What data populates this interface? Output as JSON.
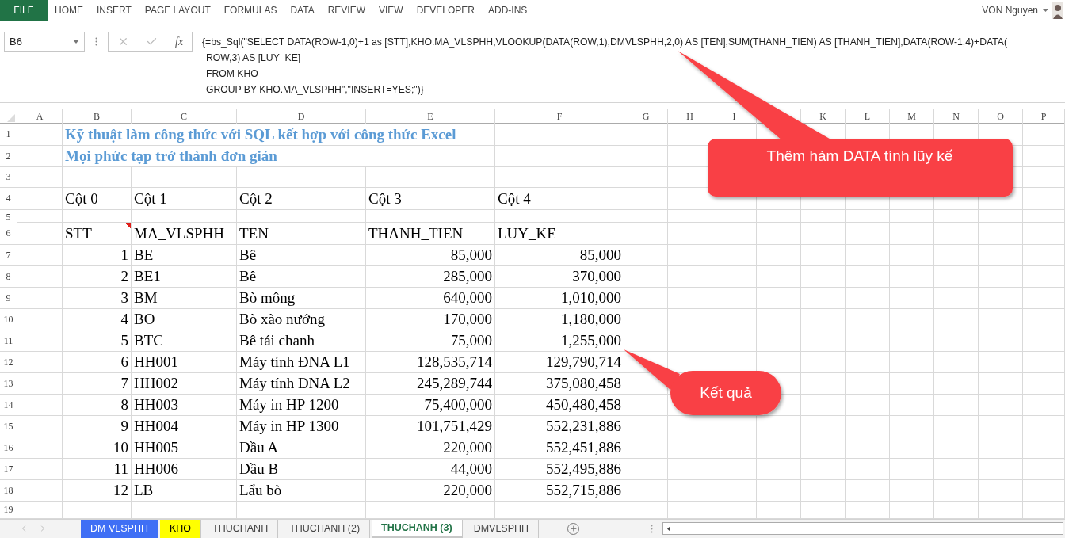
{
  "ribbon_tabs": [
    {
      "label": "FILE",
      "kind": "file"
    },
    {
      "label": "HOME",
      "kind": "tab"
    },
    {
      "label": "INSERT",
      "kind": "tab"
    },
    {
      "label": "PAGE LAYOUT",
      "kind": "tab"
    },
    {
      "label": "FORMULAS",
      "kind": "tab"
    },
    {
      "label": "DATA",
      "kind": "tab"
    },
    {
      "label": "REVIEW",
      "kind": "tab"
    },
    {
      "label": "VIEW",
      "kind": "tab"
    },
    {
      "label": "DEVELOPER",
      "kind": "tab"
    },
    {
      "label": "ADD-INS",
      "kind": "tab"
    }
  ],
  "user": {
    "name": "VON Nguyen"
  },
  "formula_bar": {
    "name_box": "B6",
    "function_label": "fx",
    "lines": [
      "{=bs_Sql(\"SELECT DATA(ROW-1,0)+1 as [STT],KHO.MA_VLSPHH,VLOOKUP(DATA(ROW,1),DMVLSPHH,2,0) AS [TEN],SUM(THANH_TIEN) AS [THANH_TIEN],DATA(ROW-1,4)+DATA(",
      "ROW,3) AS [LUY_KE]",
      "FROM KHO",
      "GROUP BY KHO.MA_VLSPHH\",\"INSERT=YES;\")}"
    ]
  },
  "columns": [
    "A",
    "B",
    "C",
    "D",
    "E",
    "F",
    "G",
    "H",
    "I",
    null,
    "K",
    "L",
    "M",
    "N",
    "O",
    "P"
  ],
  "rows": [
    {
      "number": "1",
      "kind": "title",
      "cells": {
        "B": "Kỹ thuật làm công thức với SQL kết hợp với công thức Excel"
      }
    },
    {
      "number": "2",
      "kind": "title",
      "cells": {
        "B": "Mọi phức tạp trở thành đơn giản"
      }
    },
    {
      "number": "3",
      "kind": "blank",
      "cells": {}
    },
    {
      "number": "4",
      "kind": "header",
      "cells": {
        "B": "Cột 0",
        "C": "Cột 1",
        "D": "Cột 2",
        "E": "Cột 3",
        "F": "Cột 4"
      }
    },
    {
      "number": "5",
      "kind": "spacer",
      "cells": {}
    },
    {
      "number": "6",
      "kind": "header",
      "cells": {
        "B": {
          "text": "STT",
          "comment": true
        },
        "C": "MA_VLSPHH",
        "D": "TEN",
        "E": "THANH_TIEN",
        "F": "LUY_KE"
      }
    },
    {
      "number": "7",
      "kind": "data",
      "cells": {
        "B": "1",
        "C": "BE",
        "D": "Bê",
        "E": "85,000",
        "F": "85,000"
      }
    },
    {
      "number": "8",
      "kind": "data",
      "cells": {
        "B": "2",
        "C": "BE1",
        "D": "Bê",
        "E": "285,000",
        "F": "370,000"
      }
    },
    {
      "number": "9",
      "kind": "data",
      "cells": {
        "B": "3",
        "C": "BM",
        "D": "Bò mông",
        "E": "640,000",
        "F": "1,010,000"
      }
    },
    {
      "number": "10",
      "kind": "data",
      "cells": {
        "B": "4",
        "C": "BO",
        "D": "Bò xào nướng",
        "E": "170,000",
        "F": "1,180,000"
      }
    },
    {
      "number": "11",
      "kind": "data",
      "cells": {
        "B": "5",
        "C": "BTC",
        "D": "Bê tái chanh",
        "E": "75,000",
        "F": "1,255,000"
      }
    },
    {
      "number": "12",
      "kind": "data",
      "cells": {
        "B": "6",
        "C": "HH001",
        "D": "Máy tính ĐNA L1",
        "E": "128,535,714",
        "F": "129,790,714"
      }
    },
    {
      "number": "13",
      "kind": "data",
      "cells": {
        "B": "7",
        "C": "HH002",
        "D": "Máy tính ĐNA L2",
        "E": "245,289,744",
        "F": "375,080,458"
      }
    },
    {
      "number": "14",
      "kind": "data",
      "cells": {
        "B": "8",
        "C": "HH003",
        "D": "Máy in HP 1200",
        "E": "75,400,000",
        "F": "450,480,458"
      }
    },
    {
      "number": "15",
      "kind": "data",
      "cells": {
        "B": "9",
        "C": "HH004",
        "D": "Máy in HP 1300",
        "E": "101,751,429",
        "F": "552,231,886"
      }
    },
    {
      "number": "16",
      "kind": "data",
      "cells": {
        "B": "10",
        "C": "HH005",
        "D": "Dầu A",
        "E": "220,000",
        "F": "552,451,886"
      }
    },
    {
      "number": "17",
      "kind": "data",
      "cells": {
        "B": "11",
        "C": "HH006",
        "D": "Dầu B",
        "E": "44,000",
        "F": "552,495,886"
      }
    },
    {
      "number": "18",
      "kind": "data",
      "cells": {
        "B": "12",
        "C": "LB",
        "D": "Lẩu bò",
        "E": "220,000",
        "F": "552,715,886"
      }
    },
    {
      "number": "19",
      "kind": "partial",
      "cells": {}
    }
  ],
  "callouts": [
    {
      "text": "Thêm hàm DATA tính lũy kế"
    },
    {
      "text": "Kết quả"
    }
  ],
  "sheet_tabs": [
    {
      "label": "DM VLSPHH",
      "selected": false,
      "color": "#3f6ff5"
    },
    {
      "label": "KHO",
      "selected": false,
      "color": "#ffff00"
    },
    {
      "label": "THUCHANH",
      "selected": false
    },
    {
      "label": "THUCHANH (2)",
      "selected": false
    },
    {
      "label": "THUCHANH (3)",
      "selected": true
    },
    {
      "label": "DMVLSPHH",
      "selected": false
    }
  ]
}
